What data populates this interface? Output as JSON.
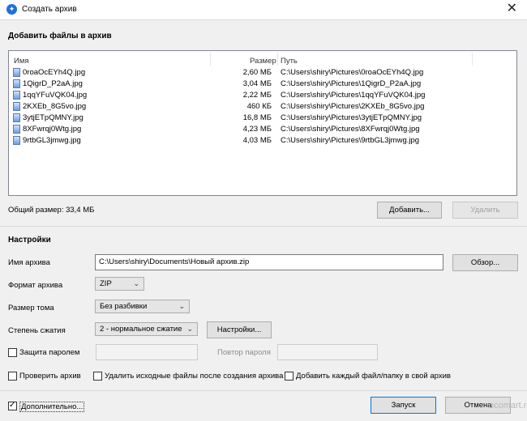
{
  "window": {
    "title": "Создать архив",
    "close": "✕"
  },
  "files_section": {
    "title": "Добавить файлы в архив",
    "columns": {
      "name": "Имя",
      "size": "Размер",
      "path": "Путь"
    },
    "files": [
      {
        "name": "0roaOcEYh4Q.jpg",
        "size": "2,60 МБ",
        "path": "C:\\Users\\shiry\\Pictures\\0roaOcEYh4Q.jpg"
      },
      {
        "name": "1QigrD_P2aA.jpg",
        "size": "3,04 МБ",
        "path": "C:\\Users\\shiry\\Pictures\\1QigrD_P2aA.jpg"
      },
      {
        "name": "1qqYFuVQK04.jpg",
        "size": "2,22 МБ",
        "path": "C:\\Users\\shiry\\Pictures\\1qqYFuVQK04.jpg"
      },
      {
        "name": "2KXEb_8G5vo.jpg",
        "size": "460 КБ",
        "path": "C:\\Users\\shiry\\Pictures\\2KXEb_8G5vo.jpg"
      },
      {
        "name": "3ytjETpQMNY.jpg",
        "size": "16,8 МБ",
        "path": "C:\\Users\\shiry\\Pictures\\3ytjETpQMNY.jpg"
      },
      {
        "name": "8XFwrqj0Wtg.jpg",
        "size": "4,23 МБ",
        "path": "C:\\Users\\shiry\\Pictures\\8XFwrqj0Wtg.jpg"
      },
      {
        "name": "9rtbGL3jmwg.jpg",
        "size": "4,03 МБ",
        "path": "C:\\Users\\shiry\\Pictures\\9rtbGL3jmwg.jpg"
      }
    ],
    "total_size": "Общий размер: 33,4 МБ",
    "add_button": "Добавить...",
    "remove_button": "Удалить"
  },
  "settings": {
    "title": "Настройки",
    "archive_name_label": "Имя архива",
    "archive_name_value": "C:\\Users\\shiry\\Documents\\Новый архив.zip",
    "browse_button": "Обзор...",
    "format_label": "Формат архива",
    "format_value": "ZIP",
    "volume_label": "Размер тома",
    "volume_value": "Без разбивки",
    "compression_label": "Степень сжатия",
    "compression_value": "2 - нормальное сжатие",
    "compression_settings_button": "Настройки...",
    "password_label": "Защита паролем",
    "password_repeat_label": "Повтор пароля",
    "check_archive_label": "Проверить архив",
    "delete_sources_label": "Удалить исходные файлы после создания архива",
    "each_separately_label": "Добавить каждый файл/папку в свой архив"
  },
  "footer": {
    "advanced_label": "Дополнительно...",
    "start_button": "Запуск",
    "cancel_button": "Отмена",
    "watermark": "ocomart.ru"
  }
}
